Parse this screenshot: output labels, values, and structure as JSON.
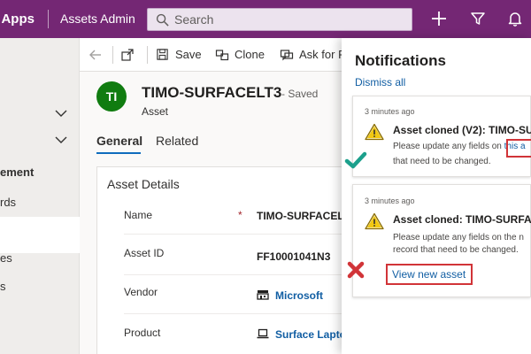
{
  "colors": {
    "brand": "#742774",
    "link": "#115ea3",
    "highlight": "#d13438",
    "success": "#1ca08c",
    "error": "#d13438",
    "avatar": "#107c10",
    "warning": "#f2c811"
  },
  "topbar": {
    "app_name": "r Apps",
    "area_name": "Assets Admin",
    "search_placeholder": "Search",
    "icons": [
      "plus-icon",
      "filter-icon",
      "bell-icon"
    ]
  },
  "leftnav": {
    "items": [
      {
        "label": "ement",
        "bold": true
      },
      {
        "label": "rds",
        "bold": false
      },
      {
        "label": "es",
        "bold": false
      },
      {
        "label": "s",
        "bold": false
      }
    ]
  },
  "commandbar": {
    "save": "Save",
    "clone": "Clone",
    "ask_for": "Ask for R"
  },
  "record": {
    "initials": "TI",
    "title": "TIMO-SURFACELT3",
    "saved_status": "- Saved",
    "entity": "Asset"
  },
  "tabs": [
    {
      "label": "General",
      "active": true
    },
    {
      "label": "Related",
      "active": false
    }
  ],
  "form": {
    "section_title": "Asset Details",
    "fields": [
      {
        "label": "Name",
        "required": "*",
        "value": "TIMO-SURFACELT"
      },
      {
        "label": "Asset ID",
        "value": "FF10001041N3"
      },
      {
        "label": "Vendor",
        "value": "Microsoft",
        "icon": "vendor-building-icon"
      },
      {
        "label": "Product",
        "value": "Surface Lapto",
        "icon": "laptop-icon"
      }
    ]
  },
  "notifications": {
    "title": "Notifications",
    "dismiss_all": "Dismiss all",
    "items": [
      {
        "time": "3 minutes ago",
        "heading": "Asset cloned (V2): TIMO-SU",
        "body_line1_prefix": "Please update any fields on ",
        "body_line1_link": "this a",
        "body_line2": "that need to be changed.",
        "marker": "check-mark-icon"
      },
      {
        "time": "3 minutes ago",
        "heading": "Asset cloned: TIMO-SURFAC",
        "body_line1": "Please update any fields on the n",
        "body_line2": "record that need to be changed.",
        "action": "View new asset",
        "marker": "x-mark-icon"
      }
    ]
  }
}
